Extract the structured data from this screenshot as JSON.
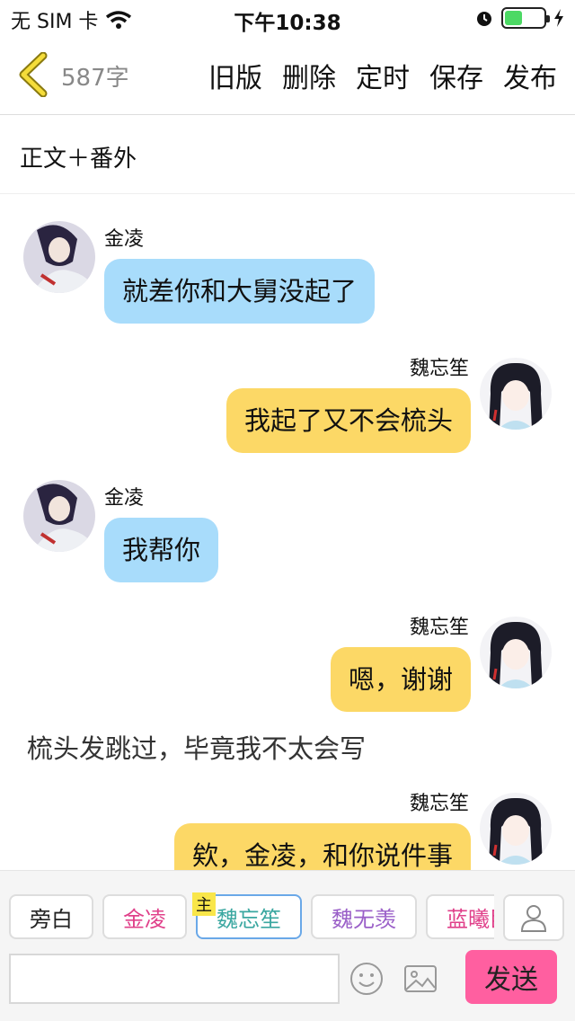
{
  "status": {
    "carrier": "无 SIM 卡",
    "time": "下午10:38",
    "battery_level": 0.45
  },
  "nav": {
    "word_count": "587字",
    "actions": [
      "旧版",
      "删除",
      "定时",
      "保存",
      "发布"
    ]
  },
  "chapter_title": "正文＋番外",
  "messages": [
    {
      "speaker": "金凌",
      "text": "就差你和大舅没起了",
      "side": "left"
    },
    {
      "speaker": "魏忘笙",
      "text": "我起了又不会梳头",
      "side": "right"
    },
    {
      "speaker": "金凌",
      "text": "我帮你",
      "side": "left"
    },
    {
      "speaker": "魏忘笙",
      "text": "嗯，谢谢",
      "side": "right"
    },
    {
      "narration": "梳头发跳过，毕竟我不太会写"
    },
    {
      "speaker": "魏忘笙",
      "text": "欸，金凌，和你说件事",
      "side": "right"
    }
  ],
  "roles": [
    {
      "label": "旁白",
      "color": "#222222"
    },
    {
      "label": "金凌",
      "color": "#e0408a"
    },
    {
      "label": "魏忘笙",
      "color": "#3aa7a0",
      "active": true,
      "main_tag": "主"
    },
    {
      "label": "魏无羡",
      "color": "#9a5fc8"
    },
    {
      "label": "蓝曦臣",
      "color": "#e0408a"
    }
  ],
  "compose": {
    "send_label": "发送",
    "input_value": ""
  },
  "colors": {
    "left_bubble": "#a8dcfb",
    "right_bubble": "#fcd866",
    "send": "#ff5fa0"
  }
}
